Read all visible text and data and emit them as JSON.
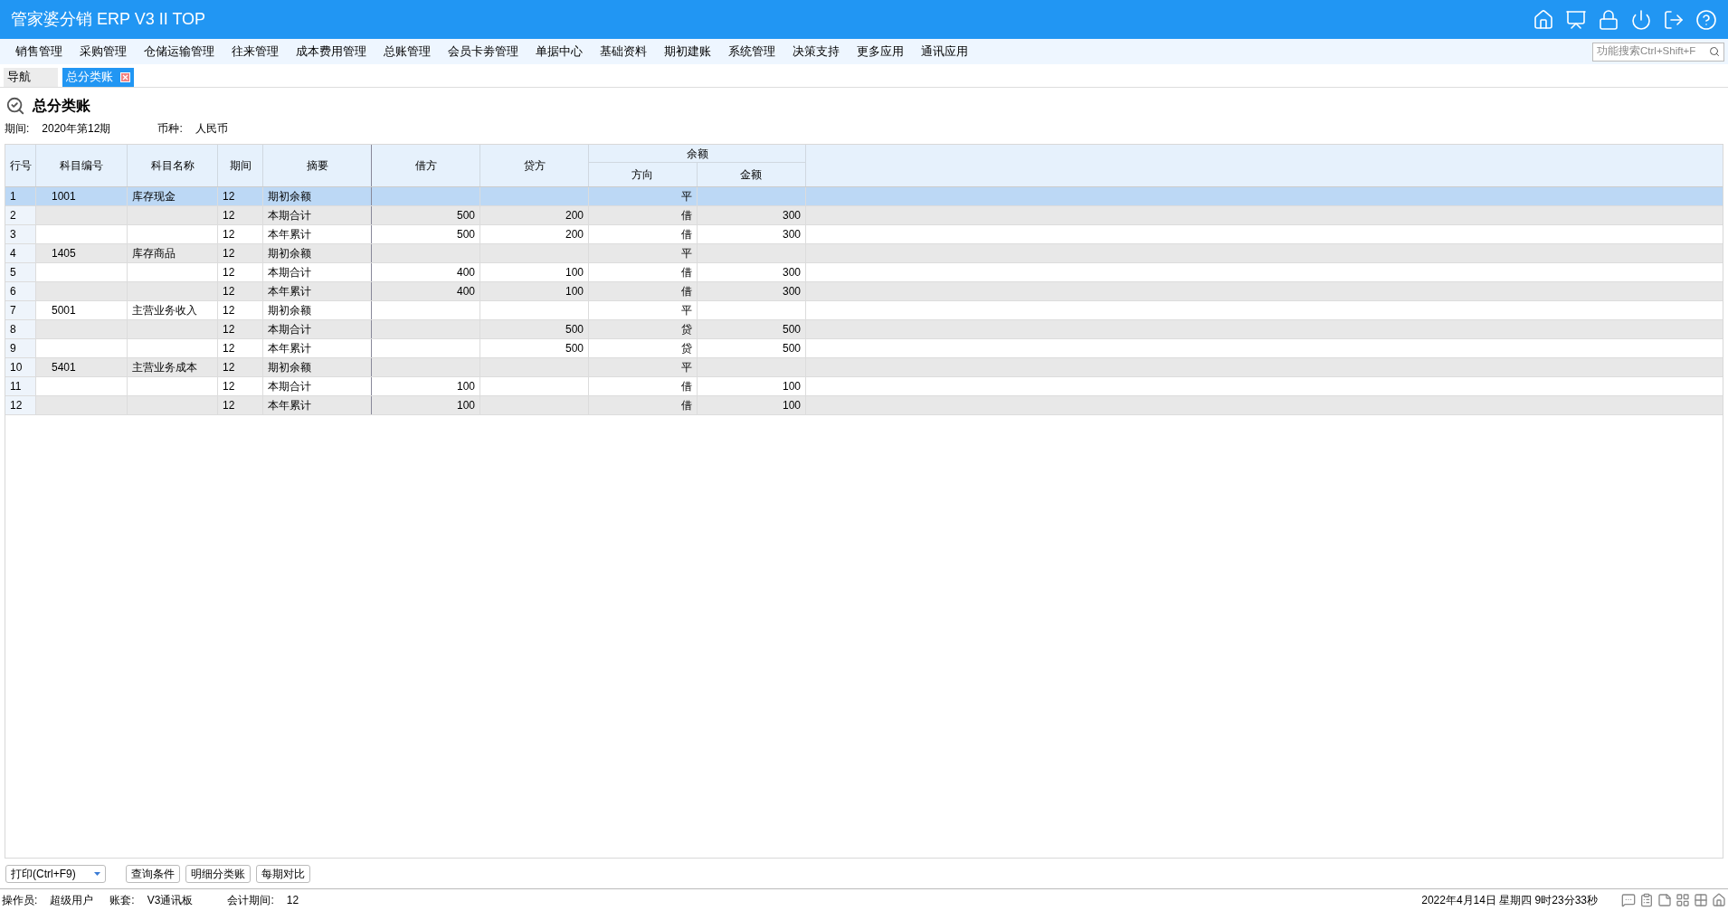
{
  "app_title": "管家婆分销 ERP V3 II TOP",
  "menu": [
    "销售管理",
    "采购管理",
    "仓储运输管理",
    "往来管理",
    "成本费用管理",
    "总账管理",
    "会员卡劵管理",
    "单据中心",
    "基础资料",
    "期初建账",
    "系统管理",
    "决策支持",
    "更多应用",
    "通讯应用"
  ],
  "search": {
    "placeholder": "功能搜索Ctrl+Shift+F"
  },
  "tabs": [
    {
      "label": "导航",
      "selected": false,
      "closable": false
    },
    {
      "label": "总分类账",
      "selected": true,
      "closable": true
    }
  ],
  "page_title": "总分类账",
  "filters": [
    {
      "label": "期间:",
      "value": "2020年第12期"
    },
    {
      "label": "币种:",
      "value": "人民币"
    }
  ],
  "table": {
    "columns": [
      "行号",
      "科目编号",
      "科目名称",
      "期间",
      "摘要",
      "借方",
      "贷方"
    ],
    "group": {
      "label": "余额",
      "columns": [
        "方向",
        "金额"
      ]
    },
    "rows": [
      {
        "cells": [
          "1",
          "1001",
          "库存现金",
          "12",
          "期初余额",
          "",
          "",
          "平",
          ""
        ],
        "selected": true
      },
      {
        "cells": [
          "2",
          "",
          "",
          "12",
          "本期合计",
          "500",
          "200",
          "借",
          "300"
        ],
        "selected": false
      },
      {
        "cells": [
          "3",
          "",
          "",
          "12",
          "本年累计",
          "500",
          "200",
          "借",
          "300"
        ],
        "selected": false
      },
      {
        "cells": [
          "4",
          "1405",
          "库存商品",
          "12",
          "期初余额",
          "",
          "",
          "平",
          ""
        ],
        "selected": false
      },
      {
        "cells": [
          "5",
          "",
          "",
          "12",
          "本期合计",
          "400",
          "100",
          "借",
          "300"
        ],
        "selected": false
      },
      {
        "cells": [
          "6",
          "",
          "",
          "12",
          "本年累计",
          "400",
          "100",
          "借",
          "300"
        ],
        "selected": false
      },
      {
        "cells": [
          "7",
          "5001",
          "主营业务收入",
          "12",
          "期初余额",
          "",
          "",
          "平",
          ""
        ],
        "selected": false
      },
      {
        "cells": [
          "8",
          "",
          "",
          "12",
          "本期合计",
          "",
          "500",
          "贷",
          "500"
        ],
        "selected": false
      },
      {
        "cells": [
          "9",
          "",
          "",
          "12",
          "本年累计",
          "",
          "500",
          "贷",
          "500"
        ],
        "selected": false
      },
      {
        "cells": [
          "10",
          "5401",
          "主营业务成本",
          "12",
          "期初余额",
          "",
          "",
          "平",
          ""
        ],
        "selected": false
      },
      {
        "cells": [
          "11",
          "",
          "",
          "12",
          "本期合计",
          "100",
          "",
          "借",
          "100"
        ],
        "selected": false
      },
      {
        "cells": [
          "12",
          "",
          "",
          "12",
          "本年累计",
          "100",
          "",
          "借",
          "100"
        ],
        "selected": false
      }
    ]
  },
  "buttons": [
    {
      "label": "打印(Ctrl+F9)",
      "kind": "dropdown"
    },
    {
      "label": "查询条件",
      "kind": "plain"
    },
    {
      "label": "明细分类账",
      "kind": "plain"
    },
    {
      "label": "每期对比",
      "kind": "plain"
    }
  ],
  "status": [
    {
      "label": "操作员:",
      "value": "超级用户"
    },
    {
      "label": "账套:",
      "value": "V3通讯板"
    },
    {
      "label": "会计期间:",
      "value": "12"
    }
  ],
  "datetime": "2022年4月14日 星期四 9时23分33秒"
}
